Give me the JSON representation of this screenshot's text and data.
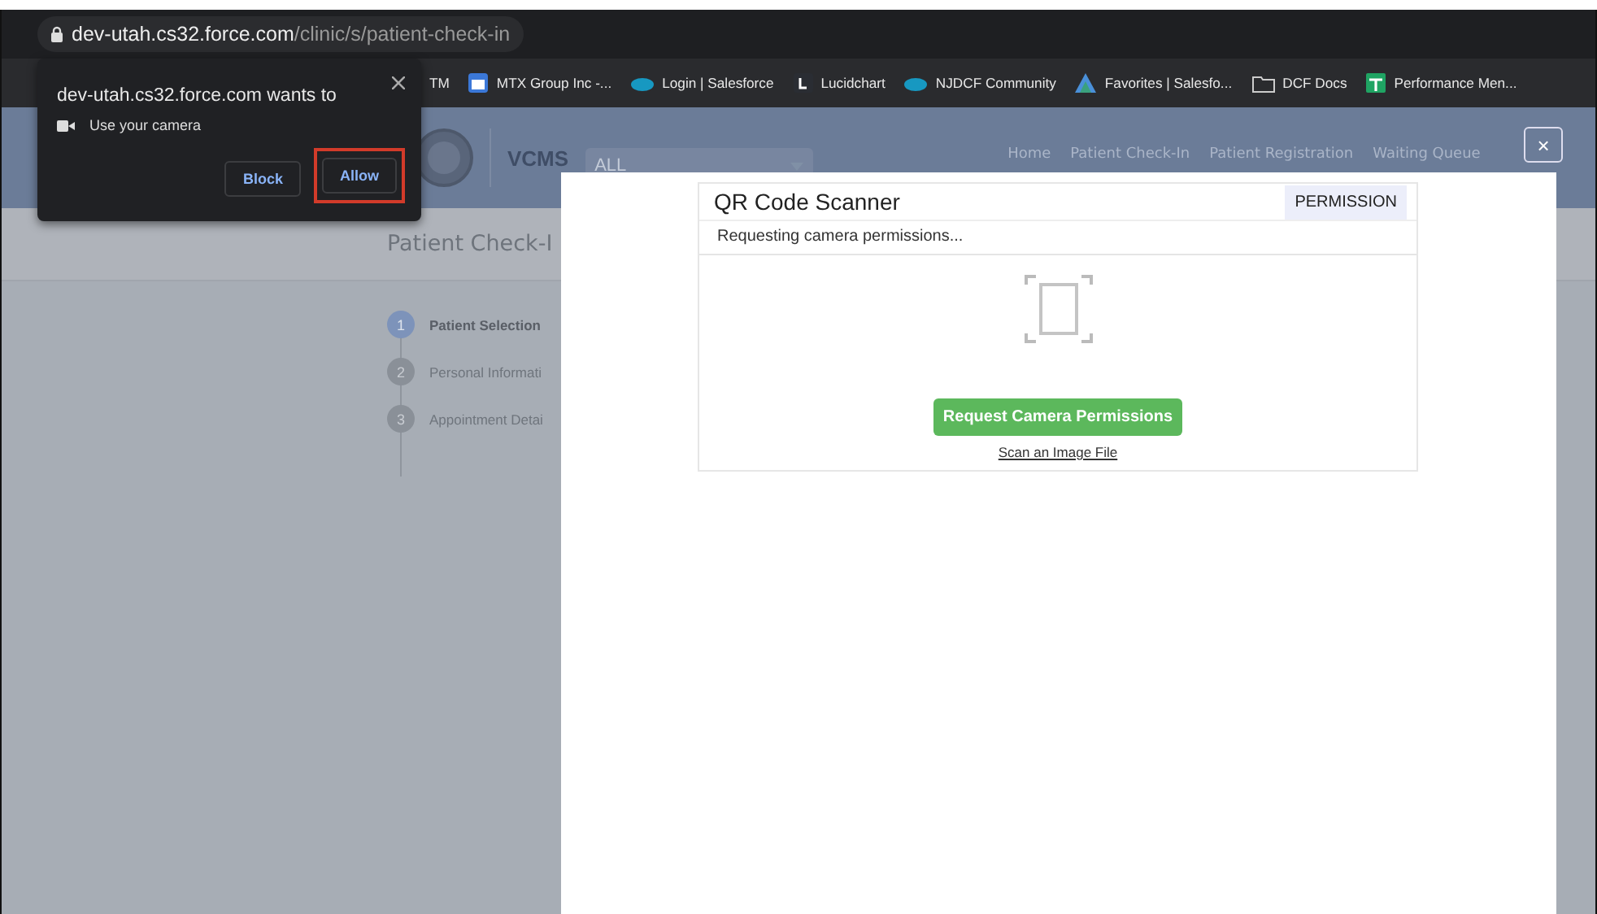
{
  "address_bar": {
    "host": "dev-utah.cs32.force.com",
    "path": "/clinic/s/patient-check-in"
  },
  "bookmarks": [
    {
      "label": "TM",
      "kind": "plain"
    },
    {
      "label": "MTX Group Inc -...",
      "kind": "calendar"
    },
    {
      "label": "Login | Salesforce",
      "kind": "cloud"
    },
    {
      "label": "Lucidchart",
      "kind": "lucid"
    },
    {
      "label": "NJDCF Community",
      "kind": "cloud"
    },
    {
      "label": "Favorites | Salesfo...",
      "kind": "triangle"
    },
    {
      "label": "DCF Docs",
      "kind": "folder"
    },
    {
      "label": "Performance Men...",
      "kind": "sheet"
    }
  ],
  "permission_popup": {
    "title": "dev-utah.cs32.force.com wants to",
    "request": "Use your camera",
    "buttons": [
      {
        "label": "Block",
        "highlighted": false
      },
      {
        "label": "Allow",
        "highlighted": true
      }
    ]
  },
  "site_header": {
    "brand": "VCMS",
    "filter": "ALL",
    "nav": [
      "Home",
      "Patient Check-In",
      "Patient Registration",
      "Waiting Queue"
    ]
  },
  "page": {
    "title": "Patient Check-I",
    "steps": [
      {
        "number": "1",
        "label": "Patient Selection",
        "active": true
      },
      {
        "number": "2",
        "label": "Personal Informati",
        "active": false
      },
      {
        "number": "3",
        "label": "Appointment Detai",
        "active": false
      }
    ]
  },
  "modal": {
    "close": "×",
    "scanner": {
      "title": "QR Code Scanner",
      "badge": "PERMISSION",
      "status": "Requesting camera permissions...",
      "button": "Request Camera Permissions",
      "link": "Scan an Image File"
    }
  }
}
